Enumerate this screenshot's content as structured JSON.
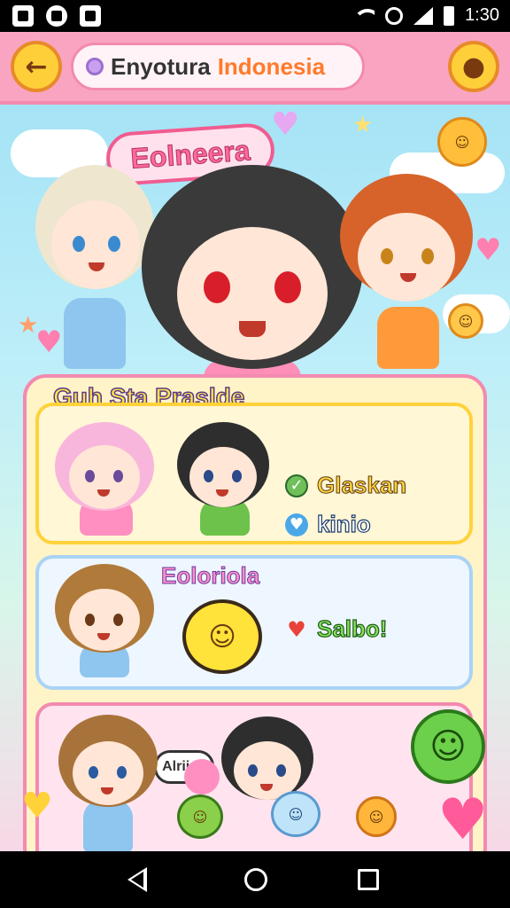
{
  "status_bar": {
    "time": "1:30",
    "icons": [
      "gallery-icon",
      "instagram-icon",
      "check-app-icon",
      "wifi-icon",
      "alarm-icon",
      "signal-icon",
      "battery-icon"
    ]
  },
  "header": {
    "back_icon": "back-arrow-icon",
    "title_part1": "Enyotura",
    "title_part2": "Indonesia",
    "profile_icon": "cat-profile-icon"
  },
  "hero": {
    "banner_text": "Eolneera"
  },
  "section": {
    "title": "Guh Sta Praslde"
  },
  "cards": [
    {
      "options": [
        {
          "label": "Glaskan",
          "icon": "check-icon",
          "color": "#ffd23a"
        },
        {
          "label": "kinio",
          "icon": "heart-icon",
          "color": "#2a8ad6"
        }
      ]
    },
    {
      "title": "Eoloriola",
      "options": [
        {
          "label": "Salbo!",
          "icon": "heart-icon",
          "color": "#2ea84a"
        }
      ]
    },
    {
      "speech": "Alriiah"
    }
  ],
  "colors": {
    "header_bg": "#f9a5c2",
    "accent_pink": "#f38ab0",
    "accent_yellow": "#ffd23a",
    "sky": "#9ee0f5"
  },
  "nav": {
    "back": "nav-back-icon",
    "home": "nav-home-icon",
    "recent": "nav-recent-icon"
  }
}
